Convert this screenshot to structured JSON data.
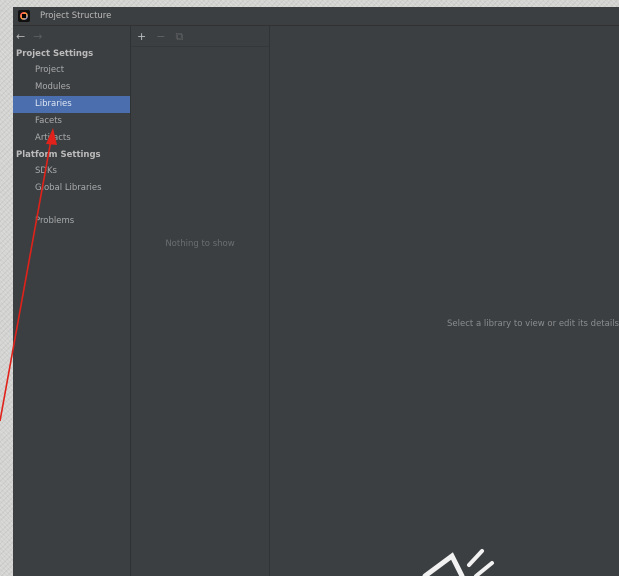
{
  "window": {
    "title": "Project Structure"
  },
  "nav": {
    "back": "←",
    "forward": "→"
  },
  "sidebar": {
    "sections": [
      {
        "label": "Project Settings",
        "items": [
          "Project",
          "Modules",
          "Libraries",
          "Facets",
          "Artifacts"
        ]
      },
      {
        "label": "Platform Settings",
        "items": [
          "SDKs",
          "Global Libraries"
        ]
      }
    ],
    "extra": [
      "Problems"
    ],
    "selected": "Libraries"
  },
  "list": {
    "add": "+",
    "remove": "−",
    "copy": "⧉",
    "empty_text": "Nothing to show"
  },
  "detail": {
    "hint": "Select a library to view or edit its details"
  },
  "colors": {
    "selection": "#4b6eaf",
    "annotation_arrow": "#e0221a",
    "background": "#3c3f41"
  },
  "icons": {
    "app": "intellij-logo-icon",
    "annotation": "red-arrow-pointer"
  }
}
